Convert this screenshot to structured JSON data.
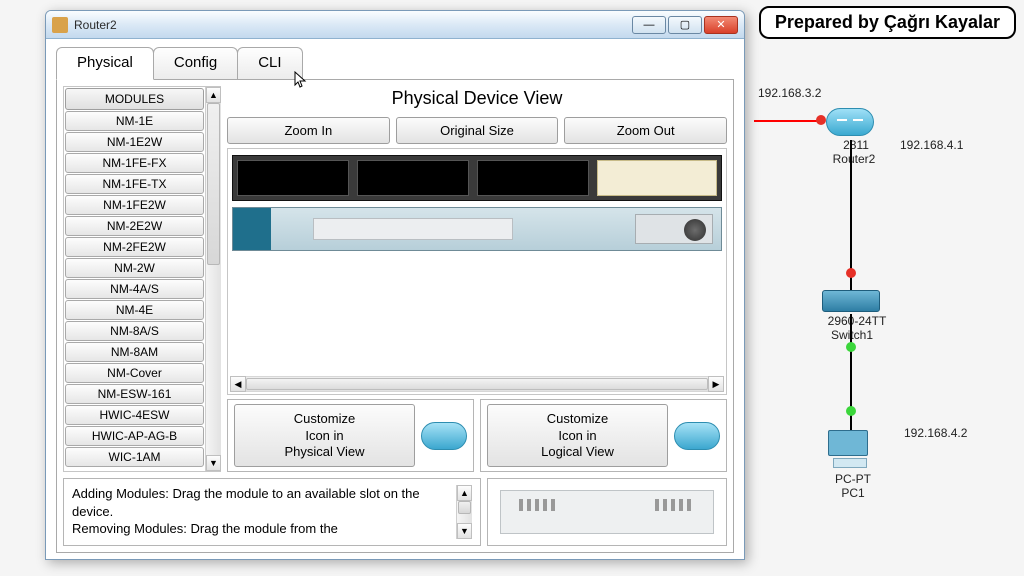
{
  "badge": {
    "text": "Prepared by Çağrı Kayalar"
  },
  "window": {
    "title": "Router2",
    "sysbtns": {
      "min": "—",
      "max": "▢",
      "close": "✕"
    }
  },
  "tabs": [
    {
      "label": "Physical",
      "active": true
    },
    {
      "label": "Config",
      "active": false
    },
    {
      "label": "CLI",
      "active": false
    }
  ],
  "modules": {
    "header": "MODULES",
    "items": [
      "NM-1E",
      "NM-1E2W",
      "NM-1FE-FX",
      "NM-1FE-TX",
      "NM-1FE2W",
      "NM-2E2W",
      "NM-2FE2W",
      "NM-2W",
      "NM-4A/S",
      "NM-4E",
      "NM-8A/S",
      "NM-8AM",
      "NM-Cover",
      "NM-ESW-161",
      "HWIC-4ESW",
      "HWIC-AP-AG-B",
      "WIC-1AM"
    ]
  },
  "physical": {
    "title": "Physical Device View",
    "zoom_in": "Zoom In",
    "original": "Original Size",
    "zoom_out": "Zoom Out",
    "customize_phys": "Customize\nIcon in\nPhysical View",
    "customize_logic": "Customize\nIcon in\nLogical View"
  },
  "help": {
    "line1": "Adding Modules: Drag the module to an available slot on the device.",
    "line2": "Removing Modules: Drag the module from the"
  },
  "topology": {
    "ip1": "192.168.3.2",
    "ip2": "192.168.4.1",
    "ip3": "192.168.4.2",
    "router_model": "2811",
    "router_name": "Router2",
    "switch_model": "2960-24TT",
    "switch_name": "Switch1",
    "pc_model": "PC-PT",
    "pc_name": "PC1"
  }
}
